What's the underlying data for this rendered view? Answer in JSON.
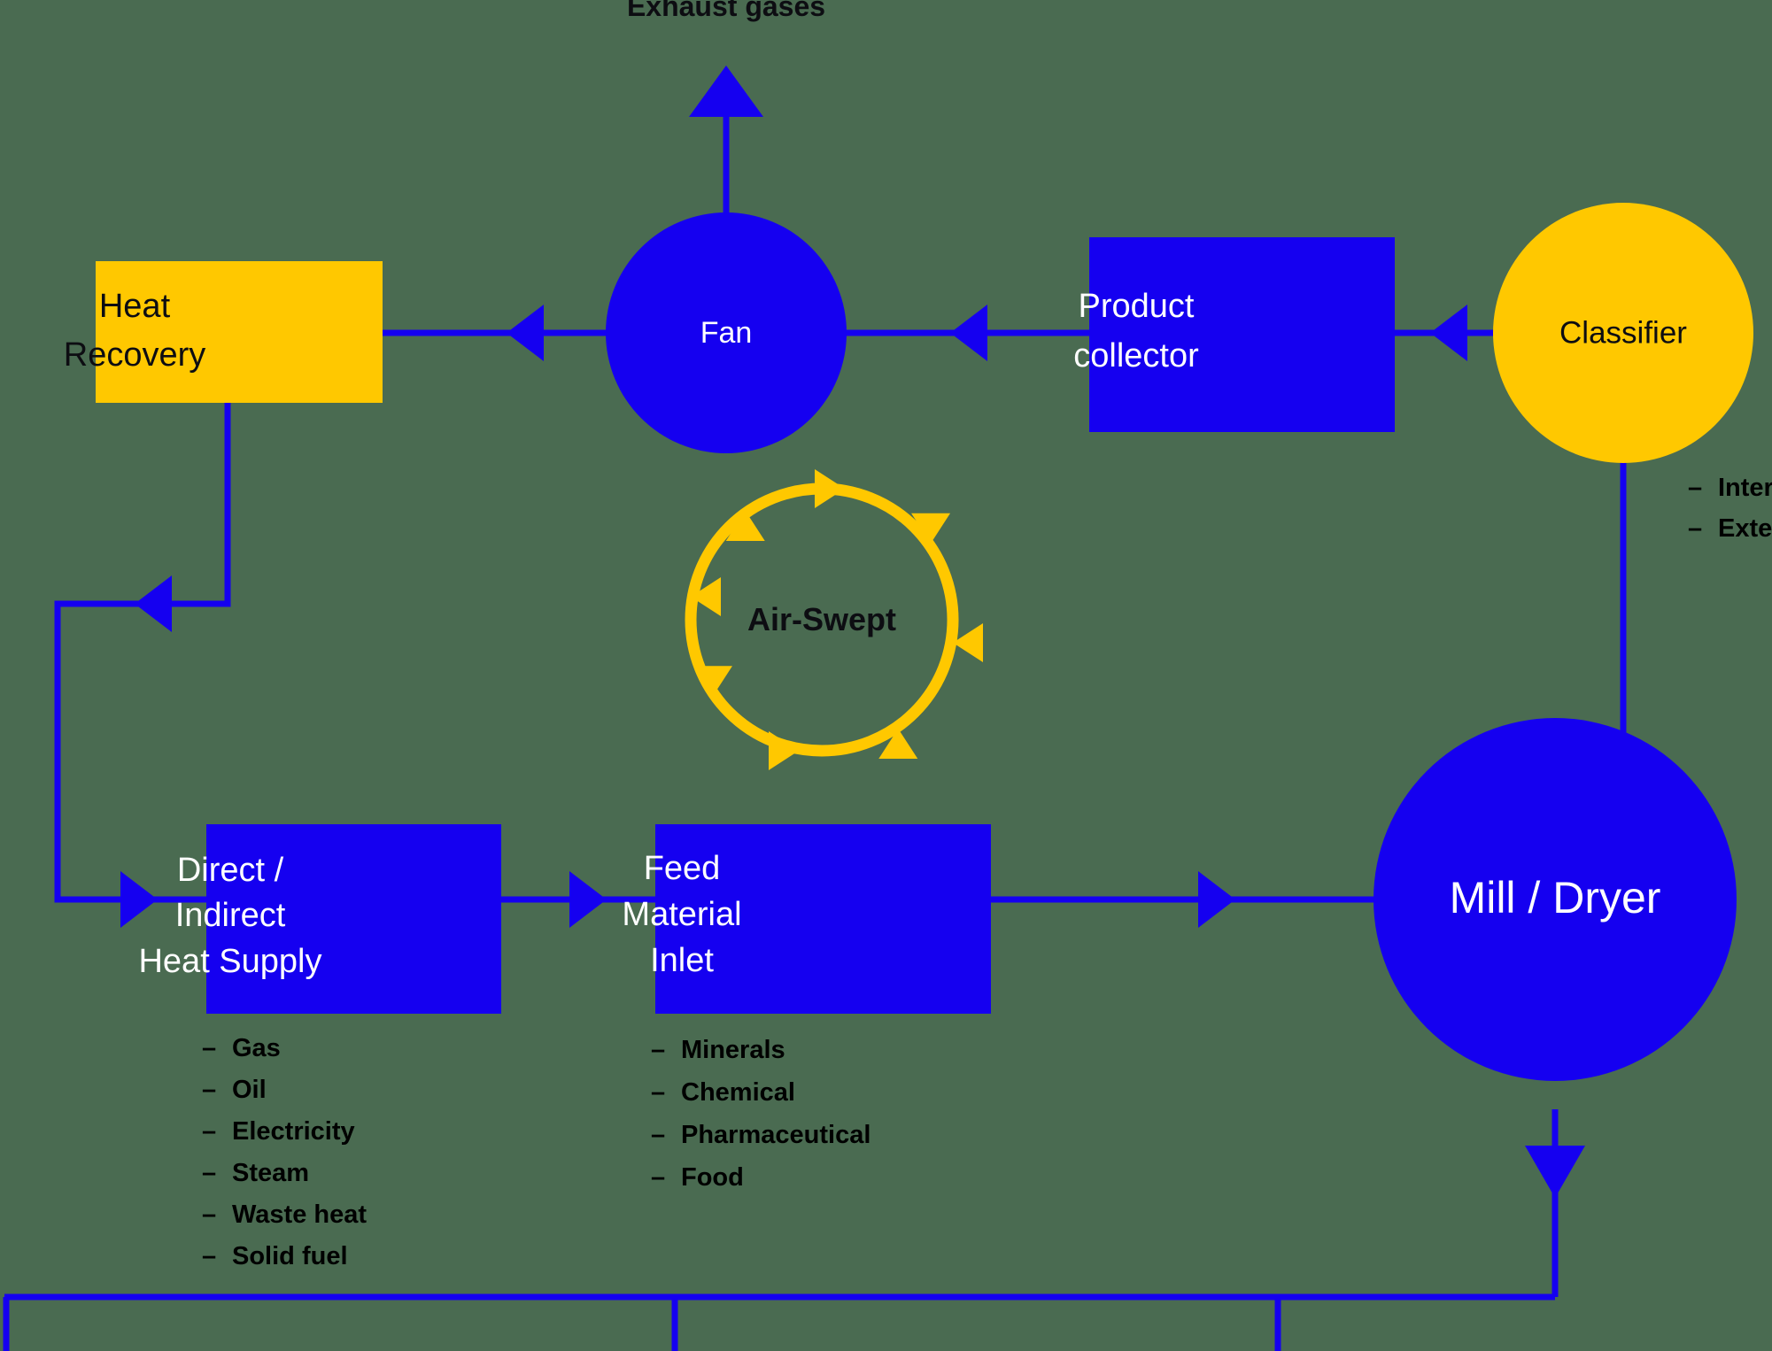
{
  "diagram": {
    "title_caption": "Exhaust gases",
    "colors": {
      "blue": "#1500f0",
      "yellow": "#ffc800",
      "text_dark": "#0d0d12",
      "text_light": "#ffffff",
      "background": "#4a6b51"
    },
    "nodes": {
      "heat_recovery": {
        "label_line1": "Heat",
        "label_line2": "Recovery",
        "shape": "rect",
        "fill": "yellow"
      },
      "fan": {
        "label": "Fan",
        "shape": "circle",
        "fill": "blue"
      },
      "product_collector": {
        "label_line1": "Product",
        "label_line2": "collector",
        "shape": "rect",
        "fill": "blue"
      },
      "classifier": {
        "label": "Classifier",
        "shape": "circle",
        "fill": "yellow"
      },
      "air_swept": {
        "label": "Air-Swept",
        "shape": "ring",
        "fill": "yellow"
      },
      "heat_supply": {
        "label_line1": "Direct /",
        "label_line2": "Indirect",
        "label_line3": "Heat Supply",
        "shape": "rect",
        "fill": "blue"
      },
      "feed_inlet": {
        "label_line1": "Feed",
        "label_line2": "Material",
        "label_line3": "Inlet",
        "shape": "rect",
        "fill": "blue"
      },
      "mill_dryer": {
        "label": "Mill / Dryer",
        "shape": "circle",
        "fill": "blue"
      }
    },
    "lists": {
      "heat_supply_options": [
        "Gas",
        "Oil",
        "Electricity",
        "Steam",
        "Waste heat",
        "Solid fuel"
      ],
      "feed_material_options": [
        "Minerals",
        "Chemical",
        "Pharmaceutical",
        "Food"
      ],
      "classifier_options": [
        "Internal",
        "External"
      ]
    },
    "bullet_marker": "–"
  }
}
